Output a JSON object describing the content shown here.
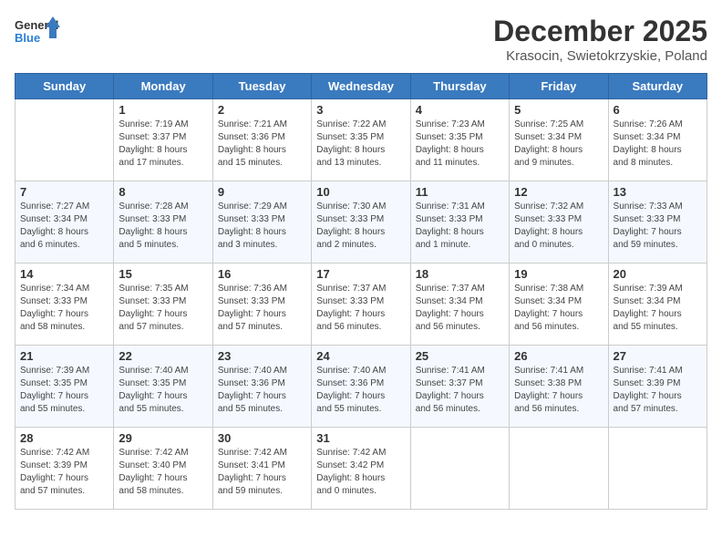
{
  "header": {
    "logo_line1": "General",
    "logo_line2": "Blue",
    "month": "December 2025",
    "location": "Krasocin, Swietokrzyskie, Poland"
  },
  "weekdays": [
    "Sunday",
    "Monday",
    "Tuesday",
    "Wednesday",
    "Thursday",
    "Friday",
    "Saturday"
  ],
  "weeks": [
    [
      {
        "day": "",
        "info": ""
      },
      {
        "day": "1",
        "info": "Sunrise: 7:19 AM\nSunset: 3:37 PM\nDaylight: 8 hours\nand 17 minutes."
      },
      {
        "day": "2",
        "info": "Sunrise: 7:21 AM\nSunset: 3:36 PM\nDaylight: 8 hours\nand 15 minutes."
      },
      {
        "day": "3",
        "info": "Sunrise: 7:22 AM\nSunset: 3:35 PM\nDaylight: 8 hours\nand 13 minutes."
      },
      {
        "day": "4",
        "info": "Sunrise: 7:23 AM\nSunset: 3:35 PM\nDaylight: 8 hours\nand 11 minutes."
      },
      {
        "day": "5",
        "info": "Sunrise: 7:25 AM\nSunset: 3:34 PM\nDaylight: 8 hours\nand 9 minutes."
      },
      {
        "day": "6",
        "info": "Sunrise: 7:26 AM\nSunset: 3:34 PM\nDaylight: 8 hours\nand 8 minutes."
      }
    ],
    [
      {
        "day": "7",
        "info": "Sunrise: 7:27 AM\nSunset: 3:34 PM\nDaylight: 8 hours\nand 6 minutes."
      },
      {
        "day": "8",
        "info": "Sunrise: 7:28 AM\nSunset: 3:33 PM\nDaylight: 8 hours\nand 5 minutes."
      },
      {
        "day": "9",
        "info": "Sunrise: 7:29 AM\nSunset: 3:33 PM\nDaylight: 8 hours\nand 3 minutes."
      },
      {
        "day": "10",
        "info": "Sunrise: 7:30 AM\nSunset: 3:33 PM\nDaylight: 8 hours\nand 2 minutes."
      },
      {
        "day": "11",
        "info": "Sunrise: 7:31 AM\nSunset: 3:33 PM\nDaylight: 8 hours\nand 1 minute."
      },
      {
        "day": "12",
        "info": "Sunrise: 7:32 AM\nSunset: 3:33 PM\nDaylight: 8 hours\nand 0 minutes."
      },
      {
        "day": "13",
        "info": "Sunrise: 7:33 AM\nSunset: 3:33 PM\nDaylight: 7 hours\nand 59 minutes."
      }
    ],
    [
      {
        "day": "14",
        "info": "Sunrise: 7:34 AM\nSunset: 3:33 PM\nDaylight: 7 hours\nand 58 minutes."
      },
      {
        "day": "15",
        "info": "Sunrise: 7:35 AM\nSunset: 3:33 PM\nDaylight: 7 hours\nand 57 minutes."
      },
      {
        "day": "16",
        "info": "Sunrise: 7:36 AM\nSunset: 3:33 PM\nDaylight: 7 hours\nand 57 minutes."
      },
      {
        "day": "17",
        "info": "Sunrise: 7:37 AM\nSunset: 3:33 PM\nDaylight: 7 hours\nand 56 minutes."
      },
      {
        "day": "18",
        "info": "Sunrise: 7:37 AM\nSunset: 3:34 PM\nDaylight: 7 hours\nand 56 minutes."
      },
      {
        "day": "19",
        "info": "Sunrise: 7:38 AM\nSunset: 3:34 PM\nDaylight: 7 hours\nand 56 minutes."
      },
      {
        "day": "20",
        "info": "Sunrise: 7:39 AM\nSunset: 3:34 PM\nDaylight: 7 hours\nand 55 minutes."
      }
    ],
    [
      {
        "day": "21",
        "info": "Sunrise: 7:39 AM\nSunset: 3:35 PM\nDaylight: 7 hours\nand 55 minutes."
      },
      {
        "day": "22",
        "info": "Sunrise: 7:40 AM\nSunset: 3:35 PM\nDaylight: 7 hours\nand 55 minutes."
      },
      {
        "day": "23",
        "info": "Sunrise: 7:40 AM\nSunset: 3:36 PM\nDaylight: 7 hours\nand 55 minutes."
      },
      {
        "day": "24",
        "info": "Sunrise: 7:40 AM\nSunset: 3:36 PM\nDaylight: 7 hours\nand 55 minutes."
      },
      {
        "day": "25",
        "info": "Sunrise: 7:41 AM\nSunset: 3:37 PM\nDaylight: 7 hours\nand 56 minutes."
      },
      {
        "day": "26",
        "info": "Sunrise: 7:41 AM\nSunset: 3:38 PM\nDaylight: 7 hours\nand 56 minutes."
      },
      {
        "day": "27",
        "info": "Sunrise: 7:41 AM\nSunset: 3:39 PM\nDaylight: 7 hours\nand 57 minutes."
      }
    ],
    [
      {
        "day": "28",
        "info": "Sunrise: 7:42 AM\nSunset: 3:39 PM\nDaylight: 7 hours\nand 57 minutes."
      },
      {
        "day": "29",
        "info": "Sunrise: 7:42 AM\nSunset: 3:40 PM\nDaylight: 7 hours\nand 58 minutes."
      },
      {
        "day": "30",
        "info": "Sunrise: 7:42 AM\nSunset: 3:41 PM\nDaylight: 7 hours\nand 59 minutes."
      },
      {
        "day": "31",
        "info": "Sunrise: 7:42 AM\nSunset: 3:42 PM\nDaylight: 8 hours\nand 0 minutes."
      },
      {
        "day": "",
        "info": ""
      },
      {
        "day": "",
        "info": ""
      },
      {
        "day": "",
        "info": ""
      }
    ]
  ]
}
